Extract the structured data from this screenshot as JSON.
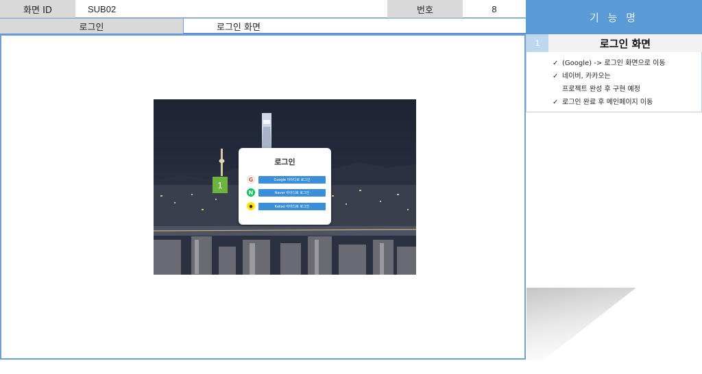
{
  "header": {
    "screen_id_label": "화면 ID",
    "screen_id_value": "SUB02",
    "number_label": "번호",
    "number_value": "8",
    "page_name": "로그인",
    "page_description": "로그인 화면"
  },
  "login_screen": {
    "title": "로그인",
    "buttons": [
      {
        "icon": "google-icon",
        "glyph": "G",
        "label": "Google 아이디로 로그인",
        "icon_color": "#ea4335"
      },
      {
        "icon": "naver-icon",
        "glyph": "N",
        "label": "Naver 아이디로 로그인",
        "icon_color": "#03c75a"
      },
      {
        "icon": "kakao-icon",
        "glyph": "●",
        "label": "Kakao 아이디로 로그인",
        "icon_color": "#fee500"
      }
    ],
    "badge": "1",
    "button_color": "#3b8fd9"
  },
  "side_panel": {
    "title": "기 능 명",
    "item_number": "1",
    "item_title": "로그인 화면",
    "notes": [
      {
        "check": "✓",
        "text": "(Google) -> 로그인 화면으로 이동"
      },
      {
        "check": "✓",
        "text": "네이버, 카카오는"
      },
      {
        "check": "",
        "text": "프로젝트 완성 후 구현 예정"
      },
      {
        "check": "✓",
        "text": "로그인 완료 후 메인페이지 이동"
      }
    ],
    "accent_color": "#5b9bd5"
  }
}
